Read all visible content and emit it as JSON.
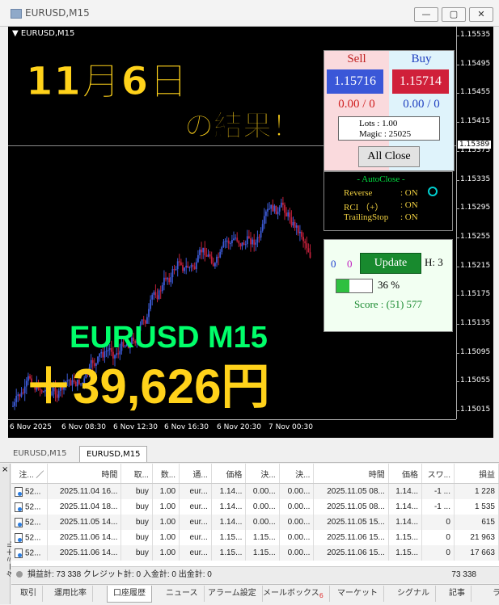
{
  "window": {
    "title": "EURUSD,M15",
    "buttons": [
      "—",
      "▢",
      "✕"
    ]
  },
  "chart": {
    "symbol_label": "EURUSD,M15",
    "price_labels": [
      "1.15535",
      "1.15495",
      "1.15455",
      "1.15415",
      "1.15375",
      "1.15335",
      "1.15295",
      "1.15255",
      "1.15215",
      "1.15175",
      "1.15135",
      "1.15095",
      "1.15055",
      "1.15015"
    ],
    "current_price": "1.15389",
    "time_labels": [
      "6 Nov 2025",
      "6 Nov 08:30",
      "6 Nov 12:30",
      "6 Nov 16:30",
      "6 Nov 20:30",
      "7 Nov 00:30"
    ],
    "colors": {
      "bull": "#3d5bd8",
      "bear": "#c0203a",
      "background": "#000000"
    }
  },
  "overlay": {
    "date_text": "11月6日",
    "result_text": "の結果！",
    "pair_text": "EURUSD M15",
    "profit_text": "＋39,626円"
  },
  "trade_panel": {
    "sell_label": "Sell",
    "buy_label": "Buy",
    "sell_price": "1.15716",
    "buy_price": "1.15714",
    "sell_pl": "0.00 / 0",
    "buy_pl": "0.00 / 0",
    "lots": "Lots   : 1.00",
    "magic": "Magic : 25025",
    "close_all": "All Close"
  },
  "autoclose_panel": {
    "title": "- AutoClose -",
    "rows": [
      {
        "label": "Reverse",
        "value": ": ON"
      },
      {
        "label": "RCI （+）",
        "value": ": ON"
      },
      {
        "label": "TrailingStop",
        "value": ": ON"
      }
    ]
  },
  "update_panel": {
    "count_a": "0",
    "count_b": "0",
    "update_label": "Update",
    "h_text": "H: 3",
    "progress": 0.36,
    "progress_text": "36 %",
    "score_text": "Score : (51) 577"
  },
  "chart_tabs": [
    "EURUSD,M15",
    "EURUSD,M15"
  ],
  "terminal": {
    "side_label": "ターミナル",
    "close_label": "×",
    "columns": [
      "注... ／",
      "時間",
      "取...",
      "数...",
      "通...",
      "価格",
      "決...",
      "決...",
      "時間",
      "価格",
      "スワ...",
      "損益"
    ],
    "rows": [
      [
        "52...",
        "2025.11.04 16...",
        "buy",
        "1.00",
        "eur...",
        "1.14...",
        "0.00...",
        "0.00...",
        "2025.11.05 08...",
        "1.14...",
        "-1 ...",
        "1 228"
      ],
      [
        "52...",
        "2025.11.04 18...",
        "buy",
        "1.00",
        "eur...",
        "1.14...",
        "0.00...",
        "0.00...",
        "2025.11.05 08...",
        "1.14...",
        "-1 ...",
        "1 535"
      ],
      [
        "52...",
        "2025.11.05 14...",
        "buy",
        "1.00",
        "eur...",
        "1.14...",
        "0.00...",
        "0.00...",
        "2025.11.05 15...",
        "1.14...",
        "0",
        "615"
      ],
      [
        "52...",
        "2025.11.06 14...",
        "buy",
        "1.00",
        "eur...",
        "1.15...",
        "1.15...",
        "0.00...",
        "2025.11.06 15...",
        "1.15...",
        "0",
        "21 963"
      ],
      [
        "52...",
        "2025.11.06 14...",
        "buy",
        "1.00",
        "eur...",
        "1.15...",
        "1.15...",
        "0.00...",
        "2025.11.06 15...",
        "1.15...",
        "0",
        "17 663"
      ]
    ],
    "summary": "損益計: 73 338  クレジット計: 0  入金計: 0  出金計: 0",
    "summary_total": "73 338",
    "tabs": [
      "取引",
      "運用比率",
      "口座履歴",
      "ニュース",
      "アラーム設定",
      "メールボックス",
      "マーケット",
      "シグナル",
      "記事",
      "ライブ"
    ],
    "mailbox_badge": "6",
    "active_tab": "口座履歴"
  }
}
